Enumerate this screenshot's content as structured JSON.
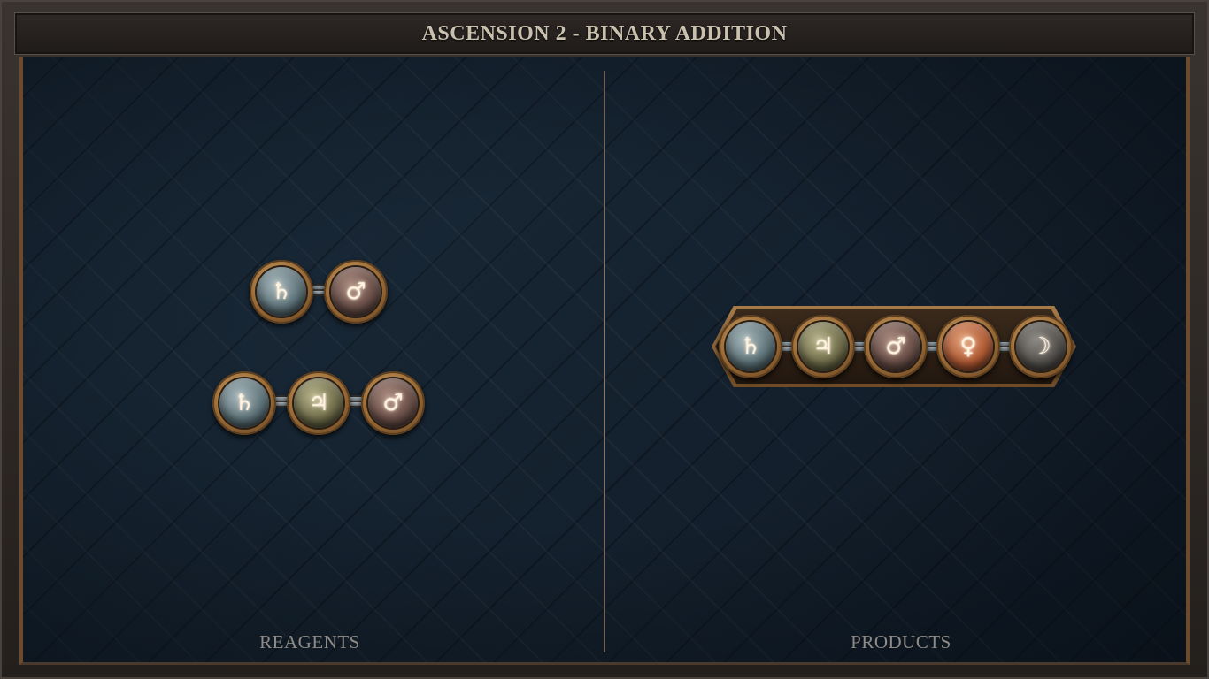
{
  "title": "ASCENSION 2 - BINARY ADDITION",
  "reagents": {
    "label": "REAGENTS",
    "molecules": [
      {
        "atoms": [
          {
            "symbol": "♄",
            "type": "salt"
          },
          {
            "symbol": "♂",
            "type": "iron"
          }
        ]
      },
      {
        "atoms": [
          {
            "symbol": "♄",
            "type": "salt"
          },
          {
            "symbol": "♃",
            "type": "tin"
          },
          {
            "symbol": "♂",
            "type": "iron"
          }
        ]
      }
    ]
  },
  "products": {
    "label": "PRODUCTS",
    "molecules": [
      {
        "atoms": [
          {
            "symbol": "♄",
            "type": "salt"
          },
          {
            "symbol": "♃",
            "type": "tin"
          },
          {
            "symbol": "♂",
            "type": "iron"
          },
          {
            "symbol": "♀",
            "type": "copper"
          },
          {
            "symbol": "☽",
            "type": "silver"
          }
        ]
      }
    ]
  },
  "colors": {
    "board": "#142230",
    "frame": "#2b2622",
    "title_text": "#c9c0ad",
    "label_text": "#8e8a85",
    "side_trim": "#6e4a2c"
  }
}
